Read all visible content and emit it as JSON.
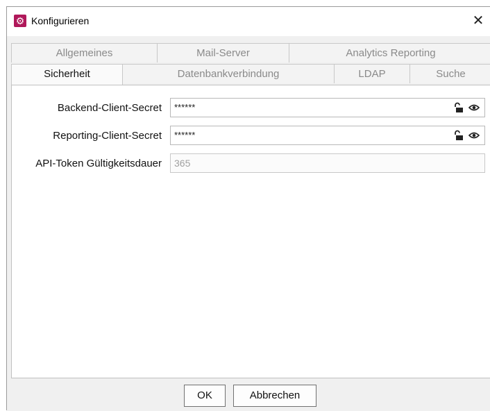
{
  "window": {
    "title": "Konfigurieren",
    "close_glyph": "✕",
    "icon": "gear-icon",
    "accent": "#b0185a"
  },
  "tabs": {
    "row1": [
      {
        "label": "Allgemeines"
      },
      {
        "label": "Mail-Server"
      },
      {
        "label": "Analytics Reporting"
      }
    ],
    "row2": [
      {
        "label": "Sicherheit",
        "active": true
      },
      {
        "label": "Datenbankverbindung"
      },
      {
        "label": "LDAP"
      },
      {
        "label": "Suche"
      }
    ]
  },
  "form": {
    "backend_label": "Backend-Client-Secret",
    "backend_value": "******",
    "reporting_label": "Reporting-Client-Secret",
    "reporting_value": "******",
    "token_label": "API-Token Gültigkeitsdauer",
    "token_value": "365"
  },
  "buttons": {
    "ok": "OK",
    "cancel": "Abbrechen"
  }
}
